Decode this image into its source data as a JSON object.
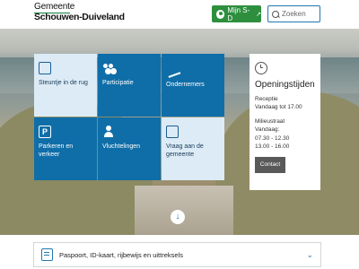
{
  "header": {
    "logo_line1": "Gemeente",
    "logo_line2": "Schouwen-Duiveland",
    "login_button": "Mijn S-D",
    "search_placeholder": "Zoeken"
  },
  "tiles": [
    {
      "label": "Steuntje in de rug",
      "icon": "money-help-icon"
    },
    {
      "label": "Participatie",
      "icon": "people-icon"
    },
    {
      "label": "Ondernemers",
      "icon": "handshake-icon"
    },
    {
      "label": "Parkeren en verkeer",
      "icon": "parking-icon"
    },
    {
      "label": "Vluchtelingen",
      "icon": "refugee-icon"
    },
    {
      "label": "Vraag aan de gemeente",
      "icon": "question-icon"
    }
  ],
  "hours": {
    "title": "Openingstijden",
    "reception_label": "Receptie",
    "reception_time": "Vandaag tot 17.00",
    "depot_label": "Milieustraat",
    "depot_day": "Vandaag:",
    "depot_time1": "07.30 - 12.30",
    "depot_time2": "13.00 - 16.00",
    "contact_button": "Contact"
  },
  "accordion": {
    "item_label": "Paspoort, ID-kaart, rijbewijs en uittreksels",
    "chevron": "chevron-down-icon"
  },
  "colors": {
    "brand_green": "#2d8f3e",
    "tile_blue": "#0f6ea8",
    "tile_light": "#dcebf5",
    "link_blue": "#1f78b4"
  }
}
